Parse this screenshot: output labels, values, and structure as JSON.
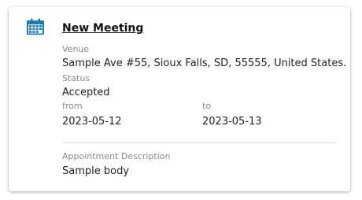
{
  "meeting": {
    "title": "New Meeting",
    "venue_label": "Venue",
    "venue_value": "Sample Ave #55, Sioux Falls, SD, 55555, United States.",
    "status_label": "Status",
    "status_value": "Accepted",
    "from_label": "from",
    "from_value": "2023-05-12",
    "to_label": "to",
    "to_value": "2023-05-13",
    "description_label": "Appointment Description",
    "description_value": "Sample body"
  },
  "icon": {
    "name": "calendar-icon",
    "color": "#1a7bb0"
  }
}
